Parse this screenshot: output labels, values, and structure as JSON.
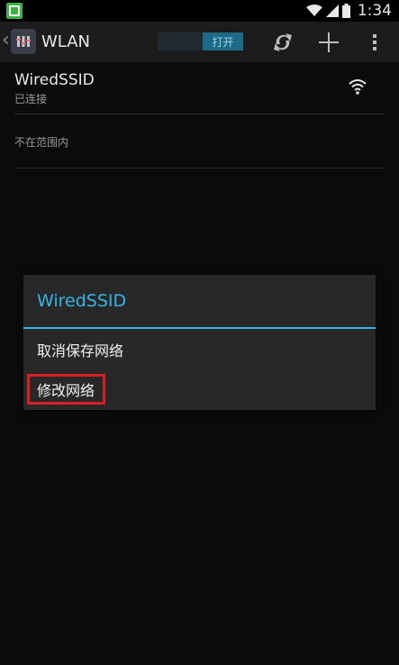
{
  "status_bar": {
    "time": "1:34"
  },
  "action_bar": {
    "title": "WLAN",
    "toggle_label": "打开"
  },
  "networks": {
    "connected": {
      "ssid": "WiredSSID",
      "status": "已连接"
    },
    "out_of_range_label": "不在范围内"
  },
  "dialog": {
    "title": "WiredSSID",
    "items": [
      "取消保存网络",
      "修改网络"
    ]
  },
  "colors": {
    "accent": "#33b5e5",
    "highlight": "#d81f26",
    "notif_green": "#3cb043"
  },
  "icons": [
    "notification-icon",
    "wifi-signal-icon",
    "cell-signal-icon",
    "battery-icon",
    "back-chevron-icon",
    "app-icon",
    "wps-icon",
    "add-icon",
    "overflow-menu-icon",
    "wifi-strength-icon"
  ]
}
